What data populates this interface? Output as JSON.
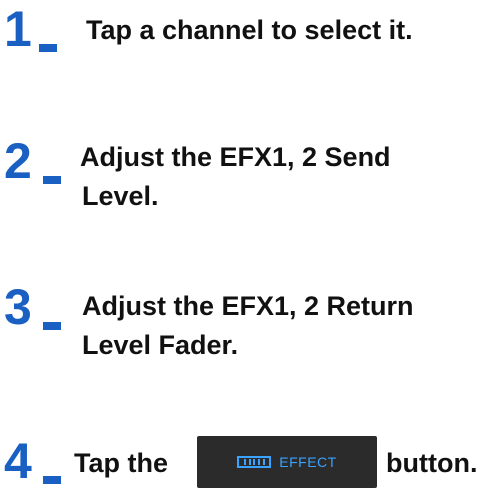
{
  "steps": [
    {
      "number": "1",
      "lines": [
        "Tap a channel to select it."
      ]
    },
    {
      "number": "2",
      "lines": [
        "Adjust the EFX1, 2 Send",
        "Level."
      ]
    },
    {
      "number": "3",
      "lines": [
        "Adjust the EFX1, 2 Return",
        "Level Fader."
      ]
    },
    {
      "number": "4",
      "prefix": "Tap the",
      "suffix": "button."
    }
  ],
  "effect_button": {
    "label": "EFFECT",
    "icon": "effect-rack-icon",
    "color": "#3aa3ff"
  },
  "colors": {
    "step_number": "#1a5fc2",
    "button_bg": "#2b2b2b"
  }
}
